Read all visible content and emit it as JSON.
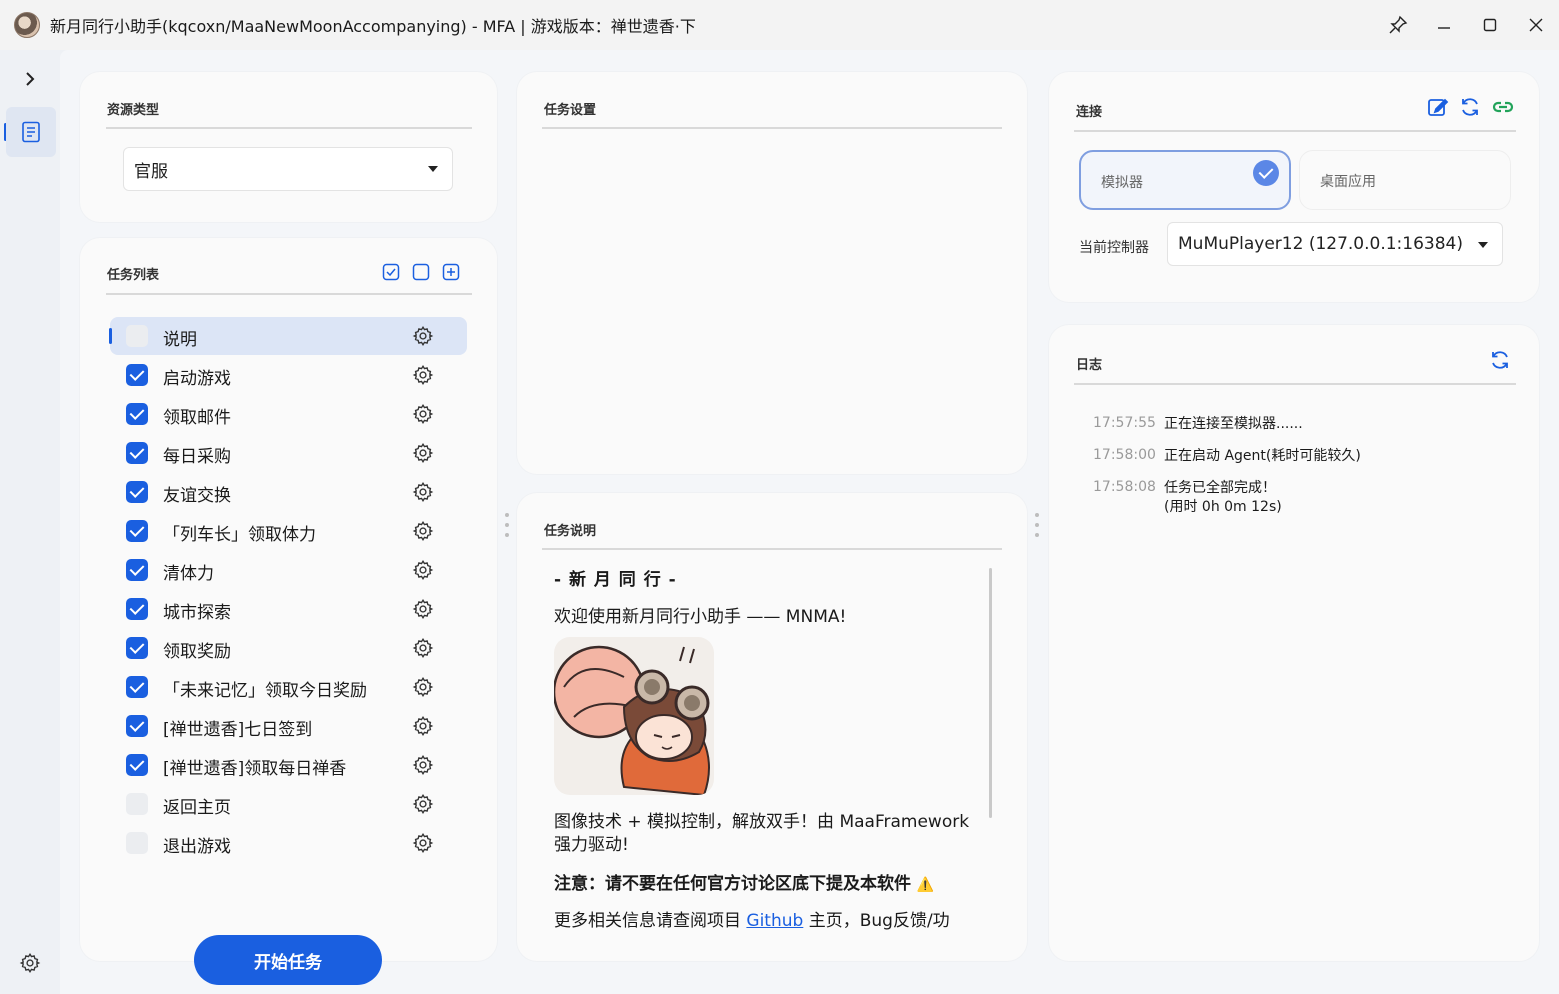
{
  "window": {
    "title": "新月同行小助手(kqcoxn/MaaNewMoonAccompanying) - MFA | 游戏版本：禅世遗香·下"
  },
  "resource": {
    "title": "资源类型",
    "selected": "官服"
  },
  "task_list": {
    "title": "任务列表",
    "items": [
      {
        "label": "说明",
        "checked": false,
        "selected": true
      },
      {
        "label": "启动游戏",
        "checked": true
      },
      {
        "label": "领取邮件",
        "checked": true
      },
      {
        "label": "每日采购",
        "checked": true
      },
      {
        "label": "友谊交换",
        "checked": true
      },
      {
        "label": "「列车长」领取体力",
        "checked": true
      },
      {
        "label": "清体力",
        "checked": true
      },
      {
        "label": "城市探索",
        "checked": true
      },
      {
        "label": "领取奖励",
        "checked": true
      },
      {
        "label": "「未来记忆」领取今日奖励",
        "checked": true
      },
      {
        "label": "[禅世遗香]七日签到",
        "checked": true
      },
      {
        "label": "[禅世遗香]领取每日禅香",
        "checked": true
      },
      {
        "label": "返回主页",
        "checked": false
      },
      {
        "label": "退出游戏",
        "checked": false
      }
    ],
    "start_button": "开始任务"
  },
  "task_settings": {
    "title": "任务设置"
  },
  "task_desc": {
    "title": "任务说明",
    "heading": "- 新 月 同 行 -",
    "welcome": "欢迎使用新月同行小助手 —— MNMA!",
    "tagline": "图像技术 + 模拟控制，解放双手！由 MaaFramework 强力驱动!",
    "notice": "注意：请不要在任何官方讨论区底下提及本软件",
    "notice_icon": "⚠️",
    "more_prefix": "更多相关信息请查阅项目 ",
    "more_link": "Github",
    "more_suffix": " 主页，Bug反馈/功"
  },
  "connect": {
    "title": "连接",
    "options": [
      "模拟器",
      "桌面应用"
    ],
    "selected_option": "模拟器",
    "controller_label": "当前控制器",
    "controller_value": "MuMuPlayer12 (127.0.0.1:16384)"
  },
  "log": {
    "title": "日志",
    "entries": [
      {
        "time": "17:57:55",
        "msg": "正在连接至模拟器......"
      },
      {
        "time": "17:58:00",
        "msg": "正在启动 Agent(耗时可能较久)"
      },
      {
        "time": "17:58:08",
        "msg": "任务已全部完成！",
        "msg2": "(用时 0h 0m 12s)"
      }
    ]
  },
  "colors": {
    "accent": "#1a5fe0",
    "connect_green": "#22a35a"
  }
}
